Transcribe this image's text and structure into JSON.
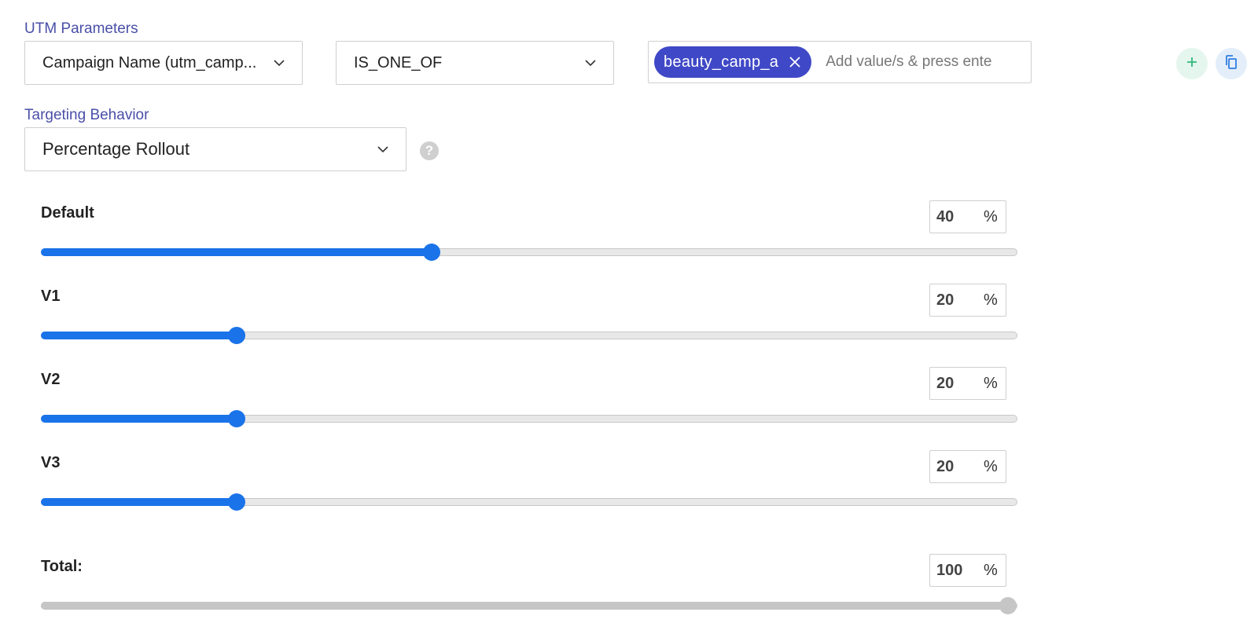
{
  "utm": {
    "section_label": "UTM Parameters",
    "parameter_value": "Campaign Name (utm_camp...",
    "operator_value": "IS_ONE_OF",
    "tags": [
      "beauty_camp_a"
    ],
    "tag_input_placeholder": "Add value/s & press ente"
  },
  "targeting": {
    "section_label": "Targeting Behavior",
    "behavior_value": "Percentage Rollout",
    "help_glyph": "?"
  },
  "rollout": {
    "unit": "%",
    "rows": [
      {
        "label": "Default",
        "value": "40",
        "fraction": 0.4
      },
      {
        "label": "V1",
        "value": "20",
        "fraction": 0.2
      },
      {
        "label": "V2",
        "value": "20",
        "fraction": 0.2
      },
      {
        "label": "V3",
        "value": "20",
        "fraction": 0.2
      }
    ],
    "total": {
      "label": "Total:",
      "value": "100",
      "fraction": 1.0
    }
  },
  "colors": {
    "accent": "#1a73e8",
    "tag_bg": "#3f48c6",
    "section_label": "#4a4fa8",
    "add_button_bg": "#e5f6ee",
    "copy_button_bg": "#e3eefa"
  },
  "icons": {
    "add": "plus-icon",
    "copy": "copy-icon",
    "remove_tag": "close-icon",
    "dropdown": "chevron-down-icon",
    "help": "help-icon"
  }
}
